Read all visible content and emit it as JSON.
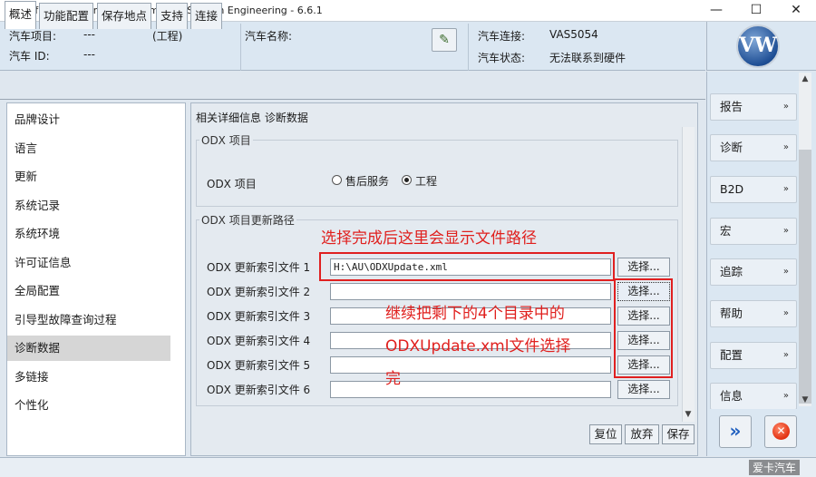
{
  "window": {
    "title": "Offboard Diagnostic Information System Engineering - 6.6.1",
    "minimize": "—",
    "maximize": "☐",
    "close": "✕"
  },
  "header": {
    "vehicle_project_label": "汽车项目:",
    "vehicle_project_value": "---",
    "mode": "(工程)",
    "vehicle_id_label": "汽车 ID:",
    "vehicle_id_value": "---",
    "vehicle_name_label": "汽车名称:",
    "vehicle_connection_label": "汽车连接:",
    "vehicle_connection_value": "VAS5054",
    "vehicle_status_label": "汽车状态:",
    "vehicle_status_value": "无法联系到硬件"
  },
  "brand": {
    "logo_text": "VW"
  },
  "tabs": [
    {
      "label": "概述",
      "active": true
    },
    {
      "label": "功能配置",
      "active": false
    },
    {
      "label": "保存地点",
      "active": false
    },
    {
      "label": "支持",
      "active": false
    },
    {
      "label": "连接",
      "active": false
    }
  ],
  "nav": {
    "items": [
      {
        "label": "品牌设计"
      },
      {
        "label": "语言"
      },
      {
        "label": "更新"
      },
      {
        "label": "系统记录"
      },
      {
        "label": "系统环境"
      },
      {
        "label": "许可证信息"
      },
      {
        "label": "全局配置"
      },
      {
        "label": "引导型故障查询过程"
      },
      {
        "label": "诊断数据",
        "selected": true
      },
      {
        "label": "多链接"
      },
      {
        "label": "个性化"
      }
    ]
  },
  "main": {
    "caption": "相关详细信息 诊断数据",
    "odx_group_title": "ODX 项目",
    "odx_project_label": "ODX 项目",
    "radio_after_sales": "售后服务",
    "radio_engineering": "工程",
    "update_group_title": "ODX 项目更新路径",
    "rows": [
      {
        "label": "ODX 更新索引文件 1",
        "value": "H:\\AU\\ODXUpdate.xml"
      },
      {
        "label": "ODX 更新索引文件 2",
        "value": ""
      },
      {
        "label": "ODX 更新索引文件 3",
        "value": ""
      },
      {
        "label": "ODX 更新索引文件 4",
        "value": ""
      },
      {
        "label": "ODX 更新索引文件 5",
        "value": ""
      },
      {
        "label": "ODX 更新索引文件 6",
        "value": ""
      }
    ],
    "select_label": "选择...",
    "reset_label": "复位",
    "discard_label": "放弃",
    "save_label": "保存"
  },
  "annotations": {
    "top_text": "选择完成后这里会显示文件路径",
    "bottom_line1": "继续把剩下的4个目录中的",
    "bottom_line2": "ODXUpdate.xml文件选择",
    "bottom_line3": "完",
    "color": "#e0201e"
  },
  "right_menu": {
    "items": [
      {
        "label": "报告"
      },
      {
        "label": "诊断"
      },
      {
        "label": "B2D"
      },
      {
        "label": "宏"
      },
      {
        "label": "追踪"
      },
      {
        "label": "帮助"
      },
      {
        "label": "配置"
      },
      {
        "label": "信息"
      }
    ],
    "chevron": "»"
  },
  "watermark": "爱卡汽车"
}
